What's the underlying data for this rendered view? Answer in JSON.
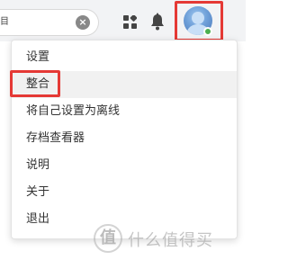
{
  "toolbar": {
    "search_partial_text": "目",
    "clear_symbol": "×",
    "icons": [
      "widgets-icon",
      "bell-icon",
      "avatar"
    ],
    "status_color": "#4caf50",
    "highlight_color": "#e53935"
  },
  "menu": {
    "items": [
      {
        "label": "设置"
      },
      {
        "label": "整合"
      },
      {
        "label": "将自己设置为离线"
      },
      {
        "label": "存档查看器"
      },
      {
        "label": "说明"
      },
      {
        "label": "关于"
      },
      {
        "label": "退出"
      }
    ]
  },
  "watermark": {
    "logo_text": "值",
    "text": "什么值得买"
  }
}
